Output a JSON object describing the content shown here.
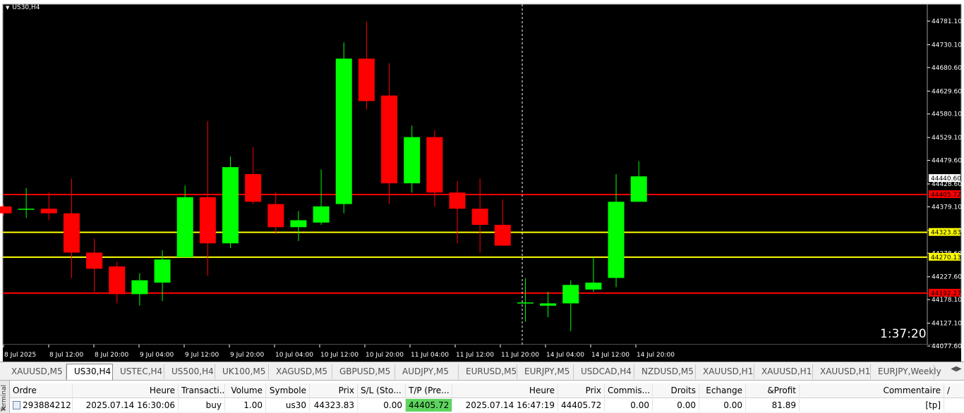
{
  "chart": {
    "symbol_label": "US30,H4",
    "countdown": "1:37:20",
    "colors": {
      "background": "#000000",
      "bull": "#00ff00",
      "bear": "#ff0000",
      "wick_bull": "#00ff00",
      "wick_bear": "#ff0000",
      "axis_text": "#ffffff",
      "crosshair": "#ffffff"
    },
    "y_ticks": [
      "44781.10",
      "44730.10",
      "44680.60",
      "44629.60",
      "44580.10",
      "44529.10",
      "44479.60",
      "44428.60",
      "44379.10",
      "44328.10",
      "44278.60",
      "44227.60",
      "44178.10",
      "44127.10",
      "44077.60"
    ],
    "x_ticks": [
      "8 Jul 2025",
      "8 Jul 12:00",
      "8 Jul 20:00",
      "9 Jul 04:00",
      "9 Jul 12:00",
      "9 Jul 20:00",
      "10 Jul 04:00",
      "10 Jul 12:00",
      "10 Jul 20:00",
      "11 Jul 04:00",
      "11 Jul 12:00",
      "11 Jul 20:00",
      "14 Jul 04:00",
      "14 Jul 12:00",
      "14 Jul 20:00"
    ],
    "levels": [
      {
        "value": 44405.72,
        "label": "44405.72",
        "color": "#ff0000"
      },
      {
        "value": 44323.83,
        "label": "44323.83",
        "color": "#ffff00"
      },
      {
        "value": 44270.13,
        "label": "44270.13",
        "color": "#ffff00"
      },
      {
        "value": 44192.27,
        "label": "44192.27",
        "color": "#ff0000"
      }
    ],
    "current_price": {
      "value": 44440.6,
      "label": "44440.60"
    }
  },
  "chart_data": {
    "type": "candlestick",
    "ylim": [
      44070,
      44820
    ],
    "candles": [
      {
        "o": 44380,
        "h": 44385,
        "l": 44360,
        "c": 44365
      },
      {
        "o": 44375,
        "h": 44420,
        "l": 44355,
        "c": 44375
      },
      {
        "o": 44375,
        "h": 44410,
        "l": 44350,
        "c": 44365
      },
      {
        "o": 44365,
        "h": 44440,
        "l": 44225,
        "c": 44280
      },
      {
        "o": 44280,
        "h": 44310,
        "l": 44195,
        "c": 44245
      },
      {
        "o": 44250,
        "h": 44260,
        "l": 44170,
        "c": 44190
      },
      {
        "o": 44190,
        "h": 44235,
        "l": 44165,
        "c": 44220
      },
      {
        "o": 44215,
        "h": 44285,
        "l": 44175,
        "c": 44265
      },
      {
        "o": 44270,
        "h": 44425,
        "l": 44270,
        "c": 44400
      },
      {
        "o": 44400,
        "h": 44565,
        "l": 44230,
        "c": 44300
      },
      {
        "o": 44300,
        "h": 44488,
        "l": 44290,
        "c": 44465
      },
      {
        "o": 44450,
        "h": 44508,
        "l": 44385,
        "c": 44390
      },
      {
        "o": 44385,
        "h": 44410,
        "l": 44320,
        "c": 44335
      },
      {
        "o": 44335,
        "h": 44370,
        "l": 44305,
        "c": 44350
      },
      {
        "o": 44345,
        "h": 44460,
        "l": 44340,
        "c": 44380
      },
      {
        "o": 44385,
        "h": 44735,
        "l": 44365,
        "c": 44700
      },
      {
        "o": 44700,
        "h": 44780,
        "l": 44590,
        "c": 44608
      },
      {
        "o": 44620,
        "h": 44690,
        "l": 44385,
        "c": 44430
      },
      {
        "o": 44430,
        "h": 44555,
        "l": 44410,
        "c": 44530
      },
      {
        "o": 44530,
        "h": 44545,
        "l": 44380,
        "c": 44410
      },
      {
        "o": 44410,
        "h": 44435,
        "l": 44300,
        "c": 44375
      },
      {
        "o": 44375,
        "h": 44440,
        "l": 44280,
        "c": 44340
      },
      {
        "o": 44340,
        "h": 44395,
        "l": 44310,
        "c": 44295
      },
      {
        "o": 44170,
        "h": 44225,
        "l": 44130,
        "c": 44172
      },
      {
        "o": 44165,
        "h": 44195,
        "l": 44140,
        "c": 44170
      },
      {
        "o": 44170,
        "h": 44220,
        "l": 44110,
        "c": 44210
      },
      {
        "o": 44200,
        "h": 44270,
        "l": 44195,
        "c": 44215
      },
      {
        "o": 44225,
        "h": 44450,
        "l": 44205,
        "c": 44390
      },
      {
        "o": 44390,
        "h": 44478,
        "l": 44390,
        "c": 44445
      }
    ]
  },
  "tabs": [
    "XAUUSD,M5",
    "US30,H4",
    "USTEC,H4",
    "US500,H4",
    "UK100,M5",
    "XAGUSD,M5",
    "GBPUSD,M5",
    "AUDJPY,M5",
    "EURUSD,M5",
    "EURJPY,M5",
    "USDCAD,H4",
    "NZDUSD,M5",
    "XAUUSD,H1",
    "XAUUSD,H1",
    "XAUUSD,H1",
    "EURJPY,Weekly"
  ],
  "active_tab_index": 1,
  "terminal": {
    "side_label": "Terminal",
    "close_glyph": "✕",
    "headers": [
      "Ordre",
      "Heure",
      "Transacti...",
      "Volume",
      "Symbole",
      "Prix",
      "S/L (Sto...",
      "T/P (Pre...",
      "Heure",
      "Prix",
      "Commis...",
      "Droits",
      "Echange",
      "&Profit",
      "Commentaire"
    ],
    "sort_glyph": "/",
    "row": [
      "293884212",
      "2025.07.14 16:30:06",
      "buy",
      "1.00",
      "us30",
      "44323.83",
      "0.00",
      "44405.72",
      "2025.07.14 16:47:19",
      "44405.72",
      "0.00",
      "0.00",
      "0.00",
      "81.89",
      "[tp]"
    ]
  }
}
